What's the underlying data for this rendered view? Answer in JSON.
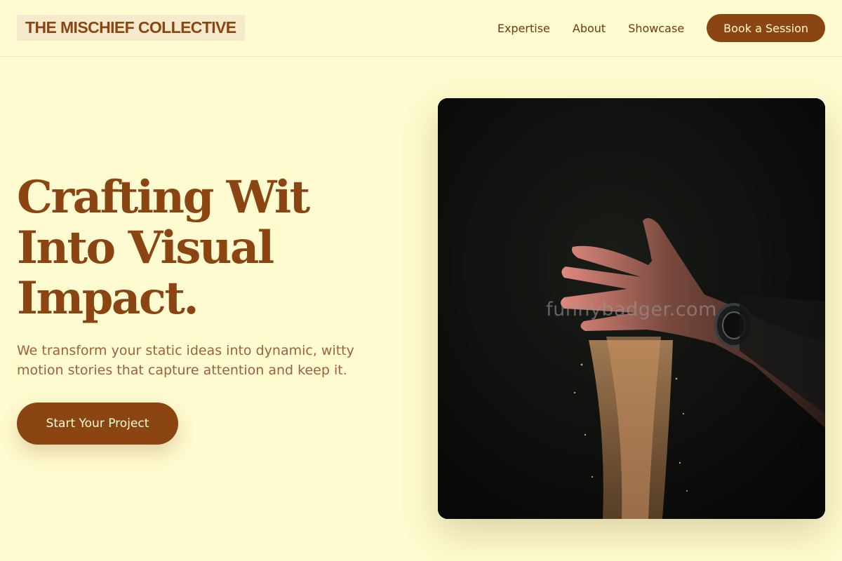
{
  "brand": {
    "name": "THE MISCHIEF COLLECTIVE"
  },
  "nav": {
    "links": [
      "Expertise",
      "About",
      "Showcase"
    ],
    "cta": "Book a Session"
  },
  "hero": {
    "title": "Crafting Wit Into Visual Impact.",
    "subtitle": "We transform your static ideas into dynamic, witty motion stories that capture attention and keep it.",
    "cta": "Start Your Project",
    "image": {
      "description": "hand releasing falling sand",
      "watermark": "funnybadger.com"
    }
  },
  "colors": {
    "background": "#fefbd0",
    "accent": "#8b4513",
    "text_muted": "#a0603a"
  }
}
